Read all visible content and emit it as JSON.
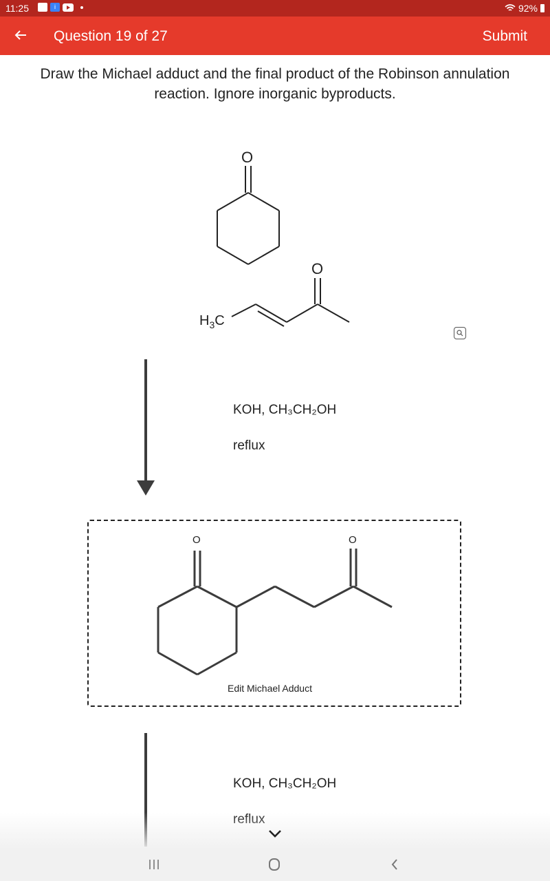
{
  "status_bar": {
    "time": "11:25",
    "battery": "92%"
  },
  "app_bar": {
    "title": "Question 19 of 27",
    "submit_label": "Submit",
    "color": "#e53a2b"
  },
  "question": {
    "text": "Draw the Michael adduct and the final product of the Robinson annulation reaction. Ignore inorganic byproducts."
  },
  "reactants": {
    "ketone_oxygen_label": "O",
    "enone_oxygen_label": "O",
    "methyl_label_main": "H",
    "methyl_label_sub": "3",
    "methyl_label_tail": "C"
  },
  "step1": {
    "reagent_line1": "KOH, CH₃CH₂OH",
    "reagent_line2": "reflux"
  },
  "adduct": {
    "oxygen_label_1": "O",
    "oxygen_label_2": "O",
    "edit_label": "Edit Michael Adduct"
  },
  "step2": {
    "reagent_line1": "KOH, CH₃CH₂OH",
    "reagent_line2": "reflux"
  },
  "icons": {
    "back": "arrow-left-icon",
    "zoom": "magnifier-icon",
    "expand": "chevron-down-icon"
  }
}
